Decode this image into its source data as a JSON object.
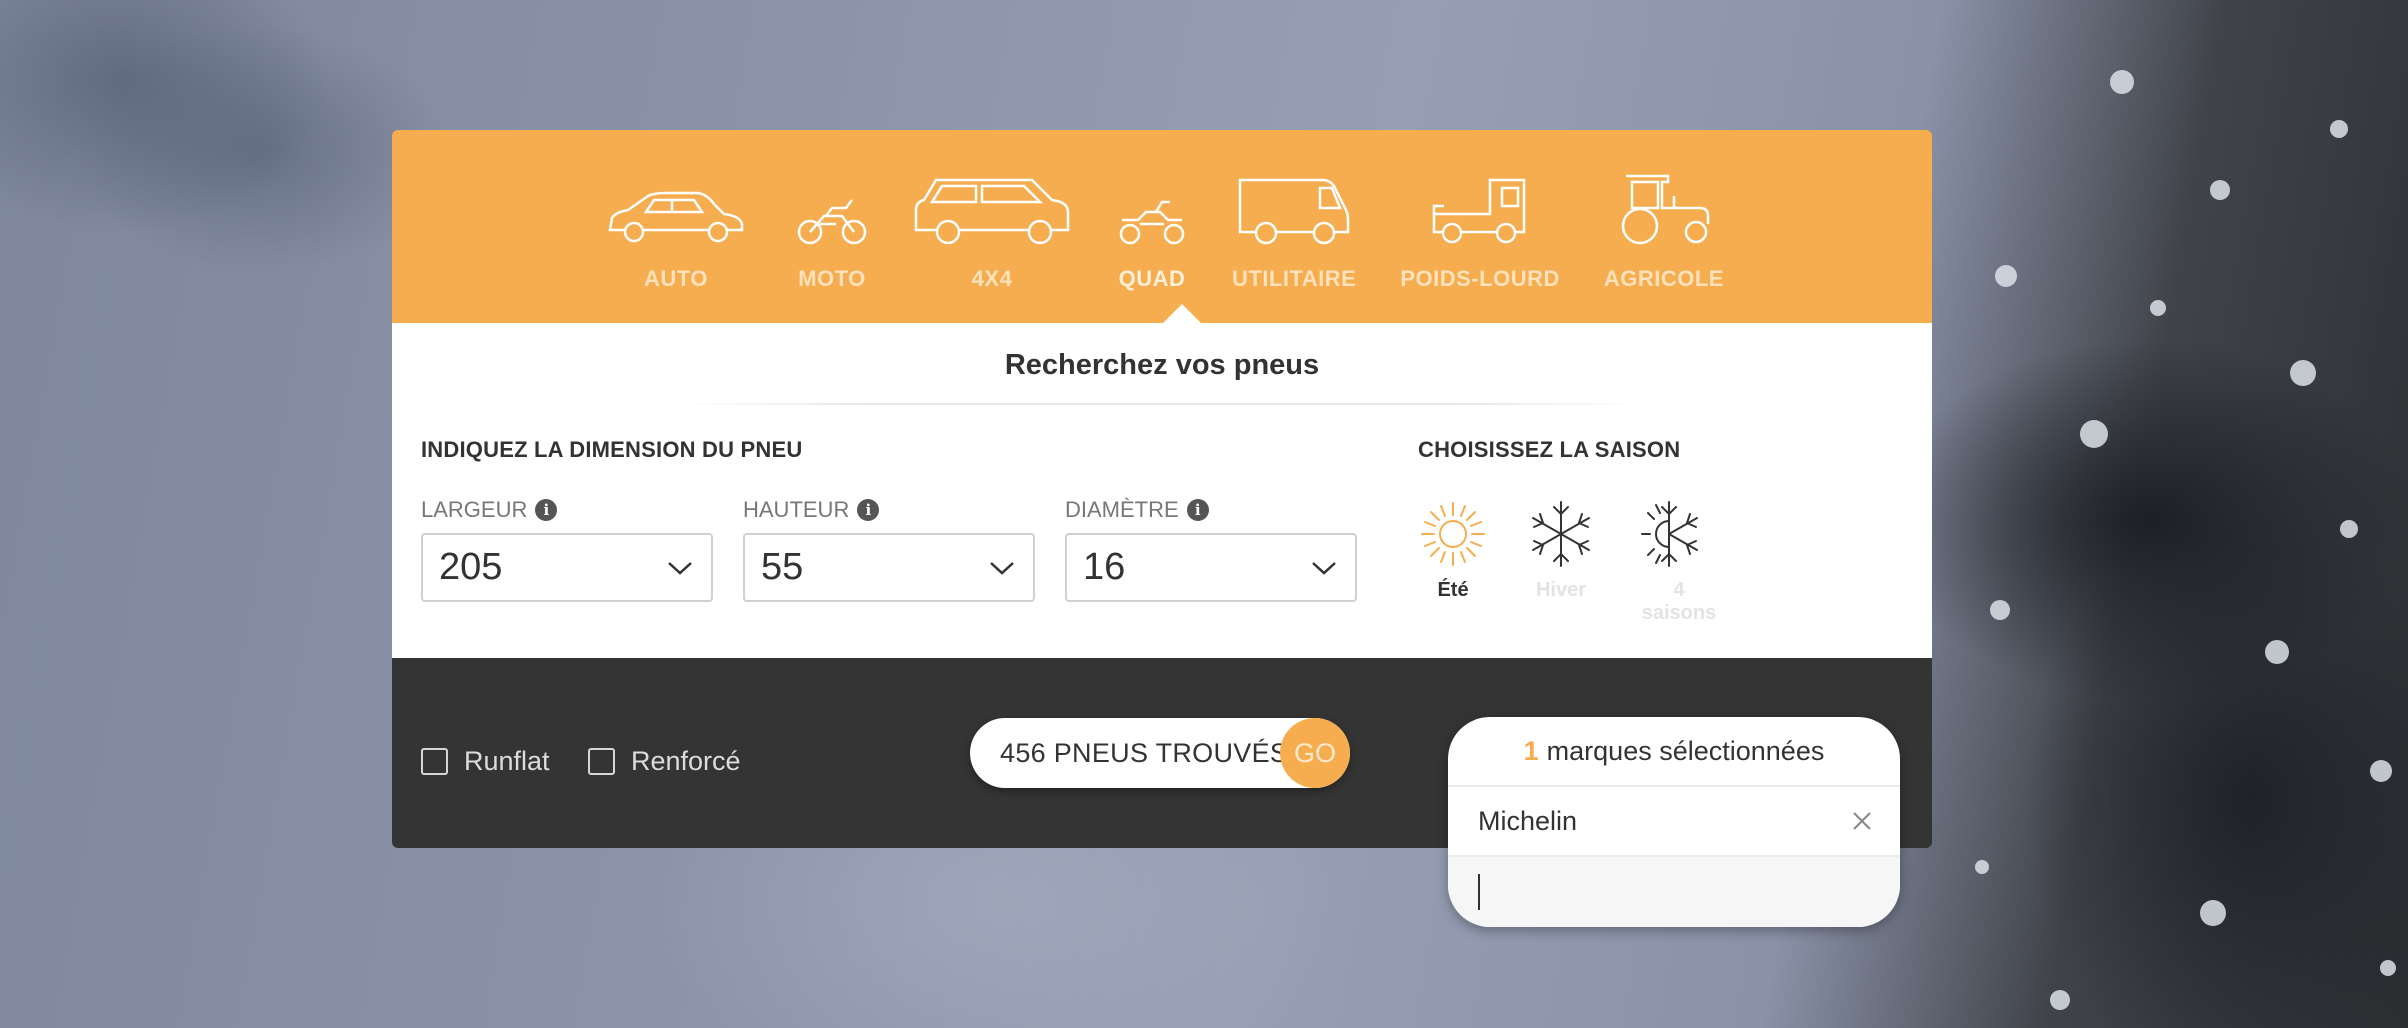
{
  "categories": [
    {
      "label": "AUTO",
      "icon": "car-icon"
    },
    {
      "label": "MOTO",
      "icon": "motorcycle-icon"
    },
    {
      "label": "4X4",
      "icon": "suv-icon"
    },
    {
      "label": "QUAD",
      "icon": "quad-icon"
    },
    {
      "label": "UTILITAIRE",
      "icon": "van-icon"
    },
    {
      "label": "POIDS-LOURD",
      "icon": "truck-icon"
    },
    {
      "label": "AGRICOLE",
      "icon": "tractor-icon"
    }
  ],
  "active_category": "QUAD",
  "search": {
    "title": "Recherchez vos pneus",
    "dimension_heading": "INDIQUEZ LA DIMENSION DU PNEU",
    "season_heading": "CHOISISSEZ LA SAISON",
    "fields": [
      {
        "label": "LARGEUR",
        "value": "205"
      },
      {
        "label": "HAUTEUR",
        "value": "55"
      },
      {
        "label": "DIAMÈTRE",
        "value": "16"
      }
    ],
    "info_glyph": "i",
    "seasons": [
      {
        "label": "Été",
        "icon": "sun-icon",
        "selected": true
      },
      {
        "label": "Hiver",
        "icon": "snowflake-icon",
        "selected": false
      },
      {
        "label": "4 saisons",
        "icon": "sun-snowflake-icon",
        "selected": false
      }
    ]
  },
  "filters": {
    "runflat_label": "Runflat",
    "renforce_label": "Renforcé",
    "results_text": "456 PNEUS TROUVÉS",
    "go_label": "GO"
  },
  "brands": {
    "count": "1",
    "header_suffix": "marques sélectionnées",
    "selected": [
      "Michelin"
    ],
    "input_value": ""
  },
  "colors": {
    "accent": "#f6ad4f",
    "dark_bar": "#343434",
    "text": "#333333"
  }
}
